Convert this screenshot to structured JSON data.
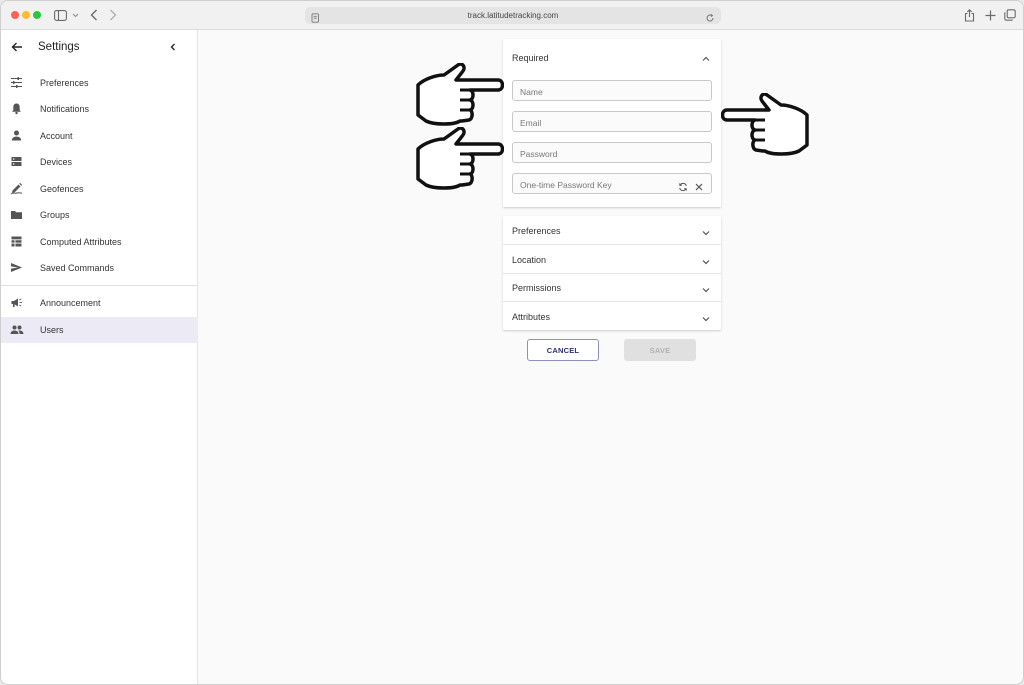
{
  "browser": {
    "url": "track.latitudetracking.com"
  },
  "sidebar": {
    "title": "Settings",
    "items": [
      {
        "label": "Preferences",
        "icon": "tune-icon"
      },
      {
        "label": "Notifications",
        "icon": "bell-icon"
      },
      {
        "label": "Account",
        "icon": "person-icon"
      },
      {
        "label": "Devices",
        "icon": "storage-icon"
      },
      {
        "label": "Geofences",
        "icon": "draw-icon"
      },
      {
        "label": "Groups",
        "icon": "folder-icon"
      },
      {
        "label": "Computed Attributes",
        "icon": "table-icon"
      },
      {
        "label": "Saved Commands",
        "icon": "send-icon"
      }
    ],
    "secondary_items": [
      {
        "label": "Announcement",
        "icon": "campaign-icon"
      },
      {
        "label": "Users",
        "icon": "people-icon",
        "active": true
      }
    ]
  },
  "form": {
    "required": {
      "title": "Required",
      "fields": {
        "name": {
          "placeholder": "Name",
          "value": ""
        },
        "email": {
          "placeholder": "Email",
          "value": ""
        },
        "password": {
          "placeholder": "Password",
          "value": ""
        },
        "otp": {
          "placeholder": "One-time Password Key",
          "value": ""
        }
      }
    },
    "sections": [
      {
        "title": "Preferences"
      },
      {
        "title": "Location"
      },
      {
        "title": "Permissions"
      },
      {
        "title": "Attributes"
      }
    ],
    "cancel_label": "CANCEL",
    "save_label": "SAVE"
  },
  "colors": {
    "active_item_bg": "#eceaf4",
    "cancel_border": "#8e8fc2",
    "cancel_text": "#2c2f6d",
    "save_disabled_bg": "#e0e0e0"
  }
}
